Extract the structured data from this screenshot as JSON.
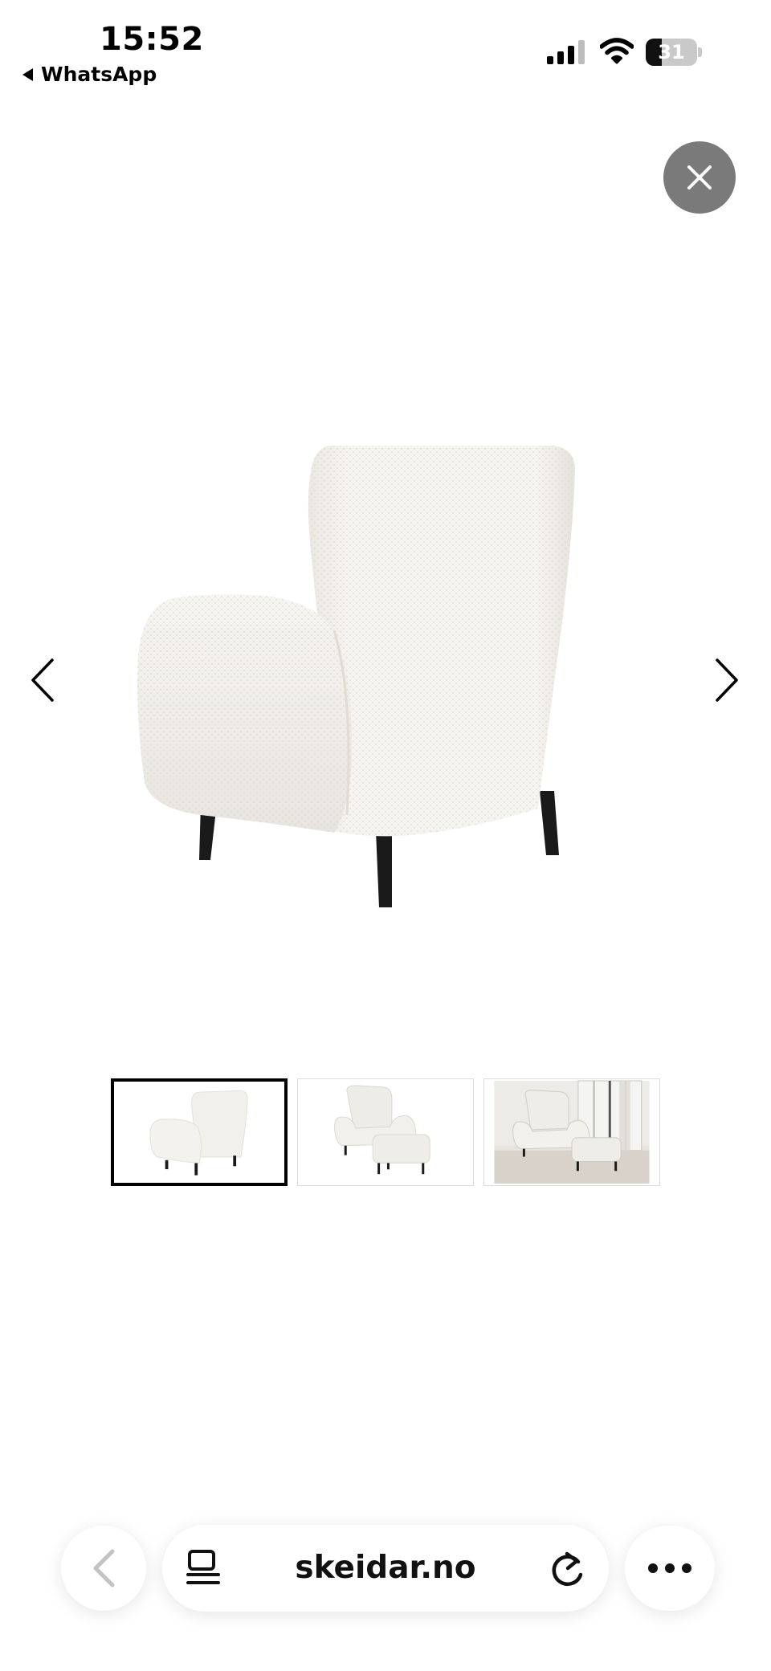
{
  "status_bar": {
    "time": "15:52",
    "back_app_label": "WhatsApp",
    "battery_percent": "31",
    "battery_level": 0.31,
    "signal_bars_active": 3,
    "icons": [
      "signal-icon",
      "wifi-icon",
      "battery-icon"
    ]
  },
  "gallery": {
    "close_icon": "close-icon",
    "prev_icon": "chevron-left-icon",
    "next_icon": "chevron-right-icon",
    "thumbnail_count": 3,
    "selected_thumbnail": 1
  },
  "browser": {
    "url": "skeidar.no",
    "icons": [
      "back-icon",
      "reader-icon",
      "reload-icon",
      "more-icon"
    ]
  },
  "colors": {
    "close_button_bg": "#7a7a7a",
    "chair_fabric": "#f3f1ec",
    "chair_legs": "#1a1a1a",
    "selected_thumb_border": "#000000"
  }
}
